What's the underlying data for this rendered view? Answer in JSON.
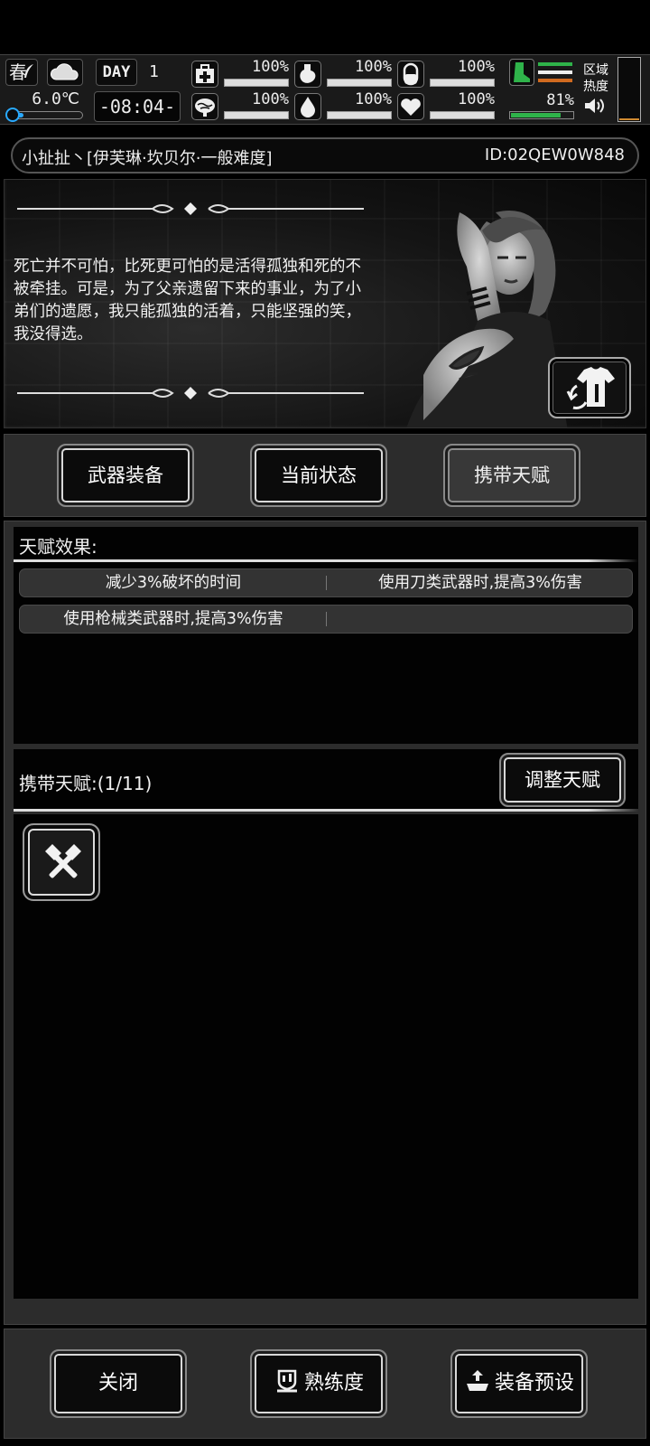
{
  "hud": {
    "season": "春",
    "temperature": "6.0℃",
    "temperature_level": 0.2,
    "day_label": "DAY",
    "day_number": "1",
    "clock": "-08:04-",
    "stats": [
      {
        "icon": "medkit-icon",
        "value": "100%",
        "level": 1.0
      },
      {
        "icon": "stomach-icon",
        "value": "100%",
        "level": 1.0
      },
      {
        "icon": "pill-icon",
        "value": "100%",
        "level": 1.0
      },
      {
        "icon": "brain-icon",
        "value": "100%",
        "level": 1.0
      },
      {
        "icon": "water-drop-icon",
        "value": "100%",
        "level": 1.0
      },
      {
        "icon": "heart-icon",
        "value": "100%",
        "level": 1.0
      }
    ],
    "stamina": {
      "icon": "boot-icon",
      "value": "81%",
      "level": 0.81
    },
    "zone_heat_label": "区域热度",
    "colors": {
      "stamina": "#2fb34a",
      "cold": "#29a9ff",
      "heat": "#d08a30"
    }
  },
  "character": {
    "name_line": "小扯扯丶[伊芙琳·坎贝尔·一般难度]",
    "id": "ID:02QEW0W848",
    "story": "死亡并不可怕，比死更可怕的是活得孤独和死的不被牵挂。可是，为了父亲遗留下来的事业，为了小弟们的遗愿，我只能孤独的活着，只能坚强的笑，我没得选。"
  },
  "tabs": [
    {
      "label": "武器装备",
      "active": false
    },
    {
      "label": "当前状态",
      "active": false
    },
    {
      "label": "携带天赋",
      "active": true
    }
  ],
  "talent_effects": {
    "title": "天赋效果:",
    "rows": [
      [
        "减少3%破坏的时间",
        "使用刀类武器时,提高3%伤害"
      ],
      [
        "使用枪械类武器时,提高3%伤害",
        ""
      ]
    ]
  },
  "carried_talents": {
    "label": "携带天赋:(1/11)",
    "adjust_button": "调整天赋",
    "slots": [
      {
        "icon": "crossed-hammers-icon"
      }
    ]
  },
  "bottom_buttons": {
    "close": "关闭",
    "proficiency": "熟练度",
    "equipment_preset": "装备预设"
  }
}
